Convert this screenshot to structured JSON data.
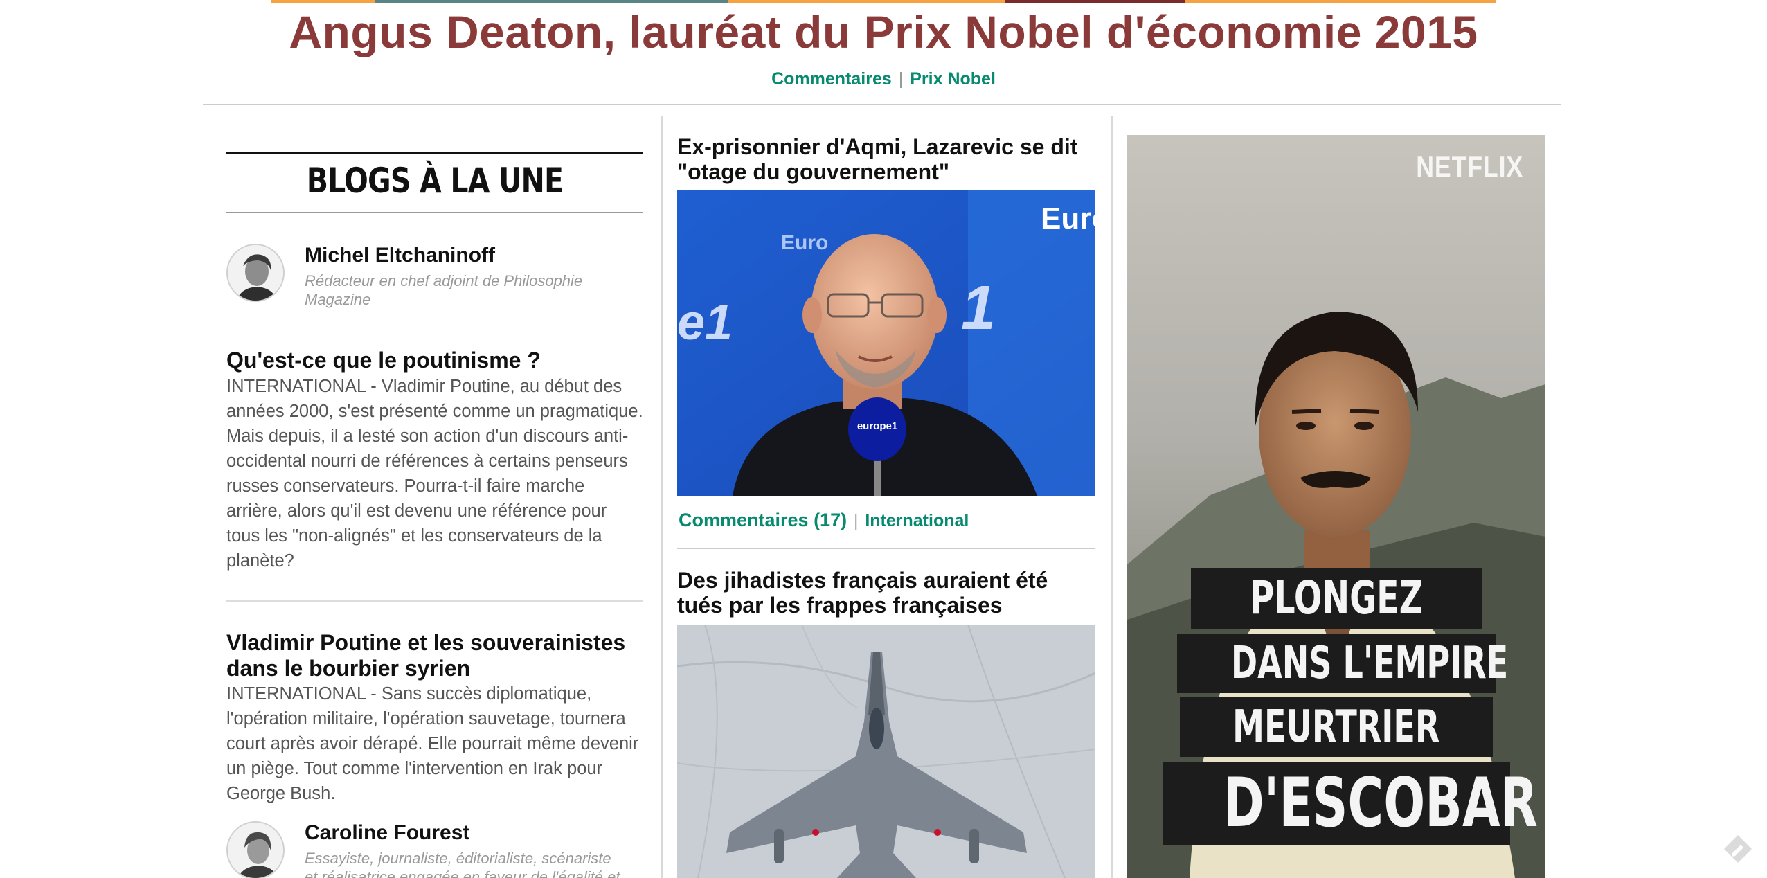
{
  "colors": {
    "headline": "#8b3a3a",
    "link_green": "#078a6f",
    "strip": [
      "#f6a243",
      "#5a8586",
      "#f6a243",
      "#7a2c2c",
      "#f6a243"
    ]
  },
  "headline": {
    "title": "Angus Deaton, lauréat du Prix Nobel d'économie 2015",
    "comments_label": "Commentaires",
    "tag_label": "Prix Nobel"
  },
  "blogs": {
    "section_title": "BLOGS À LA UNE",
    "entries": [
      {
        "author_name": "Michel Eltchaninoff",
        "author_role": "Rédacteur en chef adjoint de Philosophie Magazine",
        "avatar_icon": "author-photo",
        "posts": [
          {
            "title": "Qu'est-ce que le poutinisme ?",
            "excerpt": "INTERNATIONAL - Vladimir Poutine, au début des années 2000, s'est présenté comme un pragmatique. Mais depuis, il a lesté son action d'un discours anti-occidental nourri de références à certains penseurs russes conservateurs. Pourra-t-il faire marche arrière, alors qu'il est devenu une référence pour tous les  \"non-alignés\" et les conservateurs de la planète?"
          },
          {
            "title": "Vladimir Poutine et les souverainistes dans le bourbier syrien",
            "excerpt": "INTERNATIONAL - Sans succès diplomatique, l'opération militaire, l'opération sauvetage, tournera court après avoir dérapé. Elle pourrait même devenir un piège. Tout comme l'intervention en Irak pour George Bush."
          }
        ]
      },
      {
        "author_name": "Caroline Fourest",
        "author_role": "Essayiste, journaliste, éditorialiste, scénariste et réalisatrice engagée en faveur de l'égalité et de",
        "avatar_icon": "author-photo"
      }
    ]
  },
  "articles": [
    {
      "title": "Ex-prisonnier d'Aqmi, Lazarevic se dit \"otage du gouvernement\"",
      "image_icon": "photo-man-at-europe1-microphone",
      "image_text": {
        "top_right": "Euro",
        "backdrop_word": "Euro",
        "digit_one": "1",
        "side_mark": "e1",
        "mic_logo": "europe1"
      },
      "comments_label": "Commentaires (17)",
      "category": "International"
    },
    {
      "title": "Des jihadistes français auraient été tués par les frappes françaises",
      "image_icon": "photo-rafale-fighter-jet"
    }
  ],
  "ad": {
    "brand": "NETFLIX",
    "lines": [
      "PLONGEZ",
      "DANS L'EMPIRE",
      "MEURTRIER",
      "D'ESCOBAR"
    ],
    "image_icon": "photo-escobar-portrait"
  },
  "corner_icon": "feedback-pencil-icon"
}
